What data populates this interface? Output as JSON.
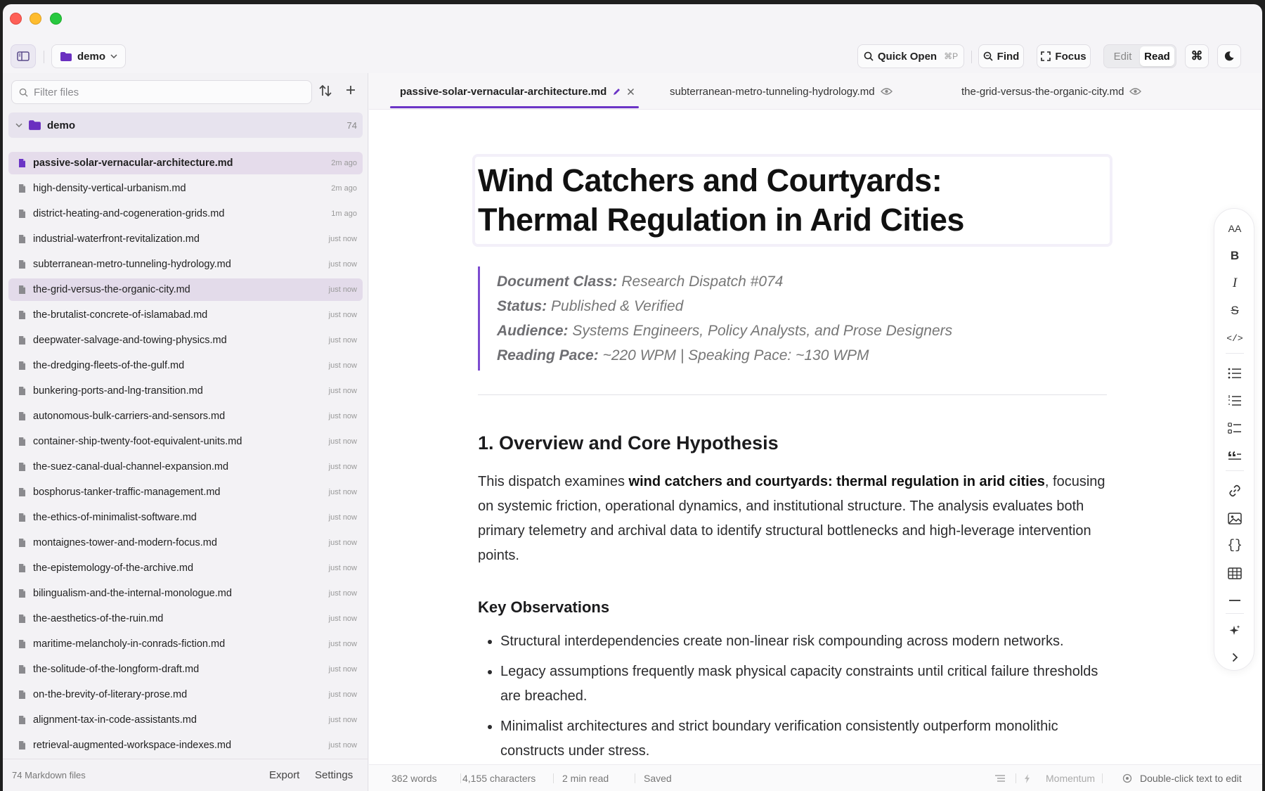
{
  "toolbar": {
    "folder_name": "demo",
    "quick_open_label": "Quick Open",
    "quick_open_shortcut": "⌘P",
    "find_label": "Find",
    "focus_label": "Focus",
    "mode_edit": "Edit",
    "mode_read": "Read",
    "cmd_glyph": "⌘"
  },
  "sidebar": {
    "filter_placeholder": "Filter files",
    "folder": {
      "name": "demo",
      "count": "74"
    },
    "files": [
      {
        "name": "passive-solar-vernacular-architecture.md",
        "time": "2m ago"
      },
      {
        "name": "high-density-vertical-urbanism.md",
        "time": "2m ago"
      },
      {
        "name": "district-heating-and-cogeneration-grids.md",
        "time": "1m ago"
      },
      {
        "name": "industrial-waterfront-revitalization.md",
        "time": "just now"
      },
      {
        "name": "subterranean-metro-tunneling-hydrology.md",
        "time": "just now"
      },
      {
        "name": "the-grid-versus-the-organic-city.md",
        "time": "just now"
      },
      {
        "name": "the-brutalist-concrete-of-islamabad.md",
        "time": "just now"
      },
      {
        "name": "deepwater-salvage-and-towing-physics.md",
        "time": "just now"
      },
      {
        "name": "the-dredging-fleets-of-the-gulf.md",
        "time": "just now"
      },
      {
        "name": "bunkering-ports-and-lng-transition.md",
        "time": "just now"
      },
      {
        "name": "autonomous-bulk-carriers-and-sensors.md",
        "time": "just now"
      },
      {
        "name": "container-ship-twenty-foot-equivalent-units.md",
        "time": "just now"
      },
      {
        "name": "the-suez-canal-dual-channel-expansion.md",
        "time": "just now"
      },
      {
        "name": "bosphorus-tanker-traffic-management.md",
        "time": "just now"
      },
      {
        "name": "the-ethics-of-minimalist-software.md",
        "time": "just now"
      },
      {
        "name": "montaignes-tower-and-modern-focus.md",
        "time": "just now"
      },
      {
        "name": "the-epistemology-of-the-archive.md",
        "time": "just now"
      },
      {
        "name": "bilingualism-and-the-internal-monologue.md",
        "time": "just now"
      },
      {
        "name": "the-aesthetics-of-the-ruin.md",
        "time": "just now"
      },
      {
        "name": "maritime-melancholy-in-conrads-fiction.md",
        "time": "just now"
      },
      {
        "name": "the-solitude-of-the-longform-draft.md",
        "time": "just now"
      },
      {
        "name": "on-the-brevity-of-literary-prose.md",
        "time": "just now"
      },
      {
        "name": "alignment-tax-in-code-assistants.md",
        "time": "just now"
      },
      {
        "name": "retrieval-augmented-workspace-indexes.md",
        "time": "just now"
      }
    ],
    "footer_count": "74 Markdown files",
    "export_label": "Export",
    "settings_label": "Settings"
  },
  "tabs": [
    {
      "label": "passive-solar-vernacular-architecture.md"
    },
    {
      "label": "subterranean-metro-tunneling-hydrology.md"
    },
    {
      "label": "the-grid-versus-the-organic-city.md"
    }
  ],
  "document": {
    "title_line1": "Wind Catchers and Courtyards:",
    "title_line2": "Thermal Regulation in Arid Cities",
    "meta": [
      {
        "key": "Document Class:",
        "value": "Research Dispatch #074"
      },
      {
        "key": "Status:",
        "value": "Published & Verified"
      },
      {
        "key": "Audience:",
        "value": "Systems Engineers, Policy Analysts, and Prose Designers"
      },
      {
        "key": "Reading Pace:",
        "value": "~220 WPM | Speaking Pace: ~130 WPM"
      }
    ],
    "section_heading": "1. Overview and Core Hypothesis",
    "para_pre": "This dispatch examines ",
    "para_bold": "wind catchers and courtyards: thermal regulation in arid cities",
    "para_post": ", focusing on systemic friction, operational dynamics, and institutional structure. The analysis evaluates both primary telemetry and archival data to identify structural bottlenecks and high-leverage intervention points.",
    "sub_heading": "Key Observations",
    "observations": [
      "Structural interdependencies create non-linear risk compounding across modern networks.",
      "Legacy assumptions frequently mask physical capacity constraints until critical failure thresholds are breached.",
      "Minimalist architectures and strict boundary verification consistently outperform monolithic constructs under stress."
    ]
  },
  "format_bar": {
    "text_size_label": "AA",
    "bold_label": "B",
    "italic_label": "I",
    "strike_label": "S",
    "code_label": "</>",
    "codeblock_label": "{}"
  },
  "status": {
    "words": "362 words",
    "chars": "4,155 characters",
    "read_time": "2 min read",
    "saved": "Saved",
    "momentum": "Momentum",
    "hint": "Double-click text to edit"
  },
  "colors": {
    "accent": "#6b34c6",
    "folder": "#6a2fc0"
  }
}
